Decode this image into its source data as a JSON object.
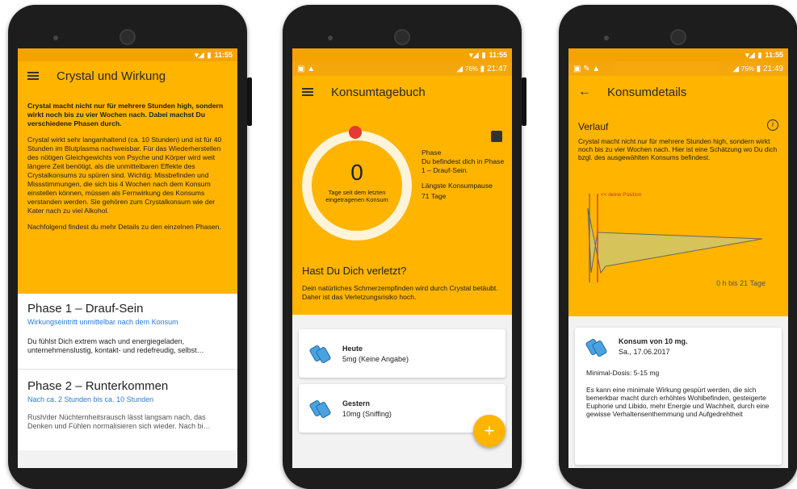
{
  "phone1": {
    "status_time": "11:55",
    "title": "Crystal und Wirkung",
    "intro_p1": "Crystal macht nicht nur für mehrere Stunden high, sondern wirkt noch bis zu vier Wochen nach. Dabei machst Du verschiedene Phasen durch.",
    "intro_p2": "Crystal wirkt sehr langanhaltend (ca. 10 Stunden) und ist für 40 Stunden im Blutplasma nachweisbar. Für das Wiederherstellen des nötigen Gleichgewichts von Psyche und Körper wird weit längere Zeit benötigt, als die unmittelbaren Effekte des Crystalkonsums zu spüren sind. Wichtig: Missbefinden und Missstimmungen, die sich bis 4 Wochen nach dem Konsum einstellen können, müssen als Fernwirkung des Konsums verstanden werden. Sie gehören zum Crystalkonsum wie der Kater nach zu viel Alkohol.",
    "intro_p3": "Nachfolgend findest du mehr Details zu den einzelnen Phasen.",
    "phases": [
      {
        "title": "Phase 1 – Drauf-Sein",
        "subtitle": "Wirkungseintritt unmittelbar nach dem Konsum",
        "text": "Du fühlst Dich extrem wach und energiegeladen, unternehmenslustig, kontakt- und redefreudig, selbst…"
      },
      {
        "title": "Phase 2 – Runterkommen",
        "subtitle": "Nach ca. 2 Stunden bis ca. 10 Stunden",
        "text": "Rush/der Nüchternheitsrausch lässt langsam nach, das Denken und Fühlen normalisieren sich wieder. Nach bi…"
      }
    ]
  },
  "phone2": {
    "status_time": "11:55",
    "status2_batt": "76%",
    "status2_time": "21:47",
    "title": "Konsumtagebuch",
    "days_value": "0",
    "days_label": "Tage seit dem letzten eingetragenen Konsum",
    "phase_label": "Phase",
    "phase_text": "Du befindest dich in Phase 1 – Drauf-Sein.",
    "pause_label": "Längste Konsumpause",
    "pause_value": "71 Tage",
    "injury_title": "Hast Du Dich verletzt?",
    "injury_text": "Dein natürliches Schmerzempfinden wird durch Crystal betäubt. Daher ist das Verletzungsrisiko hoch.",
    "entries": [
      {
        "day": "Heute",
        "detail": "5mg (Keine Angabe)"
      },
      {
        "day": "Gestern",
        "detail": "10mg (Sniffing)"
      }
    ],
    "fab": "+"
  },
  "phone3": {
    "status_time": "11:55",
    "status2_batt": "75%",
    "status2_time": "21:49",
    "title": "Konsumdetails",
    "verlauf_title": "Verlauf",
    "verlauf_text": "Crystal macht nicht nur für mehrere Stunden high, sondern wirkt noch bis zu vier Wochen nach. Hier ist eine Schätzung wo Du dich bzgl. des ausgewählten Konsums befindest.",
    "position_label": "<< deine Position",
    "range_label": "0 h bis 21 Tage",
    "entry_title": "Konsum von 10 mg.",
    "entry_date": "Sa., 17.06.2017",
    "dose_label": "Minimal-Dosis: 5-15 mg",
    "dose_text": "Es kann eine minimale Wirkung gespürt werden, die sich bemerkbar macht durch erhöhtes Wohlbefinden, gesteigerte Euphorie und Libido, mehr Energie und Wachheit, durch eine gewisse Verhaltensenthemmung und Aufgedrehtheit"
  },
  "colors": {
    "primary": "#ffb400",
    "status": "#f5a300",
    "link": "#2a7bd6",
    "accent_red": "#e53935"
  },
  "icons": [
    "menu-icon",
    "back-arrow-icon",
    "info-icon",
    "chart-icon",
    "pill-icon",
    "plus-icon",
    "wifi-icon",
    "signal-icon",
    "battery-icon"
  ]
}
